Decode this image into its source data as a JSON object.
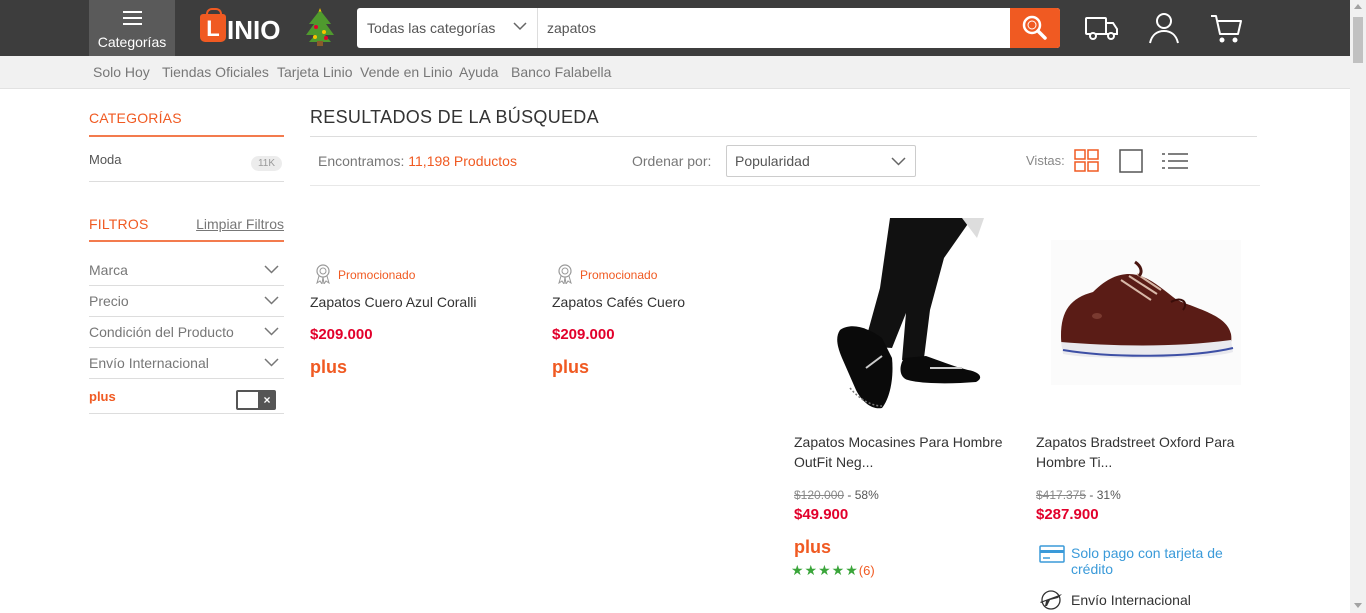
{
  "header": {
    "categories_label": "Categorías",
    "logo_text": "LINIO",
    "search": {
      "category_selected": "Todas las categorías",
      "query": "zapatos"
    },
    "brand_color": "#f05a22"
  },
  "subnav": [
    {
      "label": "Solo Hoy"
    },
    {
      "label": "Tiendas Oficiales"
    },
    {
      "label": "Tarjeta Linio"
    },
    {
      "label": "Vende en Linio"
    },
    {
      "label": "Ayuda"
    },
    {
      "label": "Banco Falabella"
    }
  ],
  "sidebar": {
    "categories_title": "CATEGORÍAS",
    "categories": [
      {
        "label": "Moda",
        "count": "11K"
      }
    ],
    "filters_title": "FILTROS",
    "clear_filters": "Limpiar Filtros",
    "filters": [
      {
        "label": "Marca"
      },
      {
        "label": "Precio"
      },
      {
        "label": "Condición del Producto"
      },
      {
        "label": "Envío Internacional"
      }
    ],
    "plus_label": "plus",
    "plus_toggle_symbol": "×"
  },
  "results": {
    "title": "RESULTADOS DE LA BÚSQUEDA",
    "found_prefix": "Encontramos:",
    "found_count": "11,198 Productos",
    "order_label": "Ordenar por:",
    "order_value": "Popularidad",
    "views_label": "Vistas:"
  },
  "products": [
    {
      "promo": "Promocionado",
      "name": "Zapatos Cuero Azul Coralli",
      "price": "$209.000",
      "plus": "plus"
    },
    {
      "promo": "Promocionado",
      "name": "Zapatos Cafés Cuero",
      "price": "$209.000",
      "plus": "plus"
    },
    {
      "name": "Zapatos Mocasines Para Hombre OutFit Neg...",
      "old_price": "$120.000",
      "discount": "- 58%",
      "price": "$49.900",
      "plus": "plus",
      "stars": "★★★★★",
      "reviews": "(6)"
    },
    {
      "name": "Zapatos Bradstreet Oxford Para Hombre Ti...",
      "old_price": "$417.375",
      "discount": "- 31%",
      "price": "$287.900",
      "credit_note": "Solo pago con tarjeta de crédito",
      "shipping_note": "Envío Internacional"
    }
  ]
}
